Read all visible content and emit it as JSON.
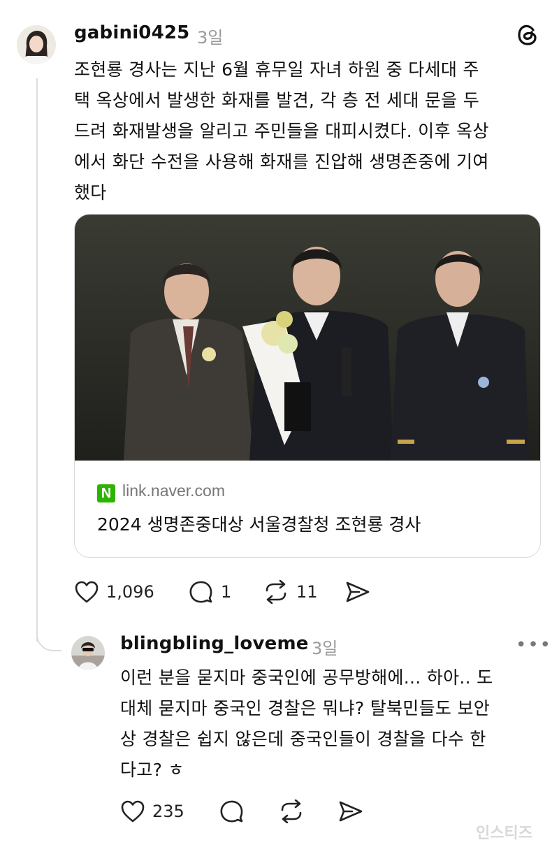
{
  "post": {
    "username": "gabini0425",
    "time": "3일",
    "app_icon": "threads-logo-icon",
    "text": "조현룡 경사는 지난 6월 휴무일 자녀 하원 중 다세대 주\n택 옥상에서 발생한 화재를 발견, 각 층 전 세대 문을 두\n드려 화재발생을 알리고 주민들을 대피시켰다. 이후 옥상\n에서 화단 수전을 사용해 화재를 진압해 생명존중에 기여\n했다",
    "link_card": {
      "domain": "link.naver.com",
      "badge": "N",
      "title": "2024 생명존중대상 서울경찰청 조현룡 경사"
    },
    "actions": {
      "likes": "1,096",
      "comments": "1",
      "reposts": "11"
    }
  },
  "reply": {
    "username": "blingbling_loveme",
    "time": "3일",
    "more": "•••",
    "text": "이런 분을 묻지마 중국인에 공무방해에... 하아.. 도\n대체 묻지마 중국인 경찰은 뭐냐? 탈북민들도 보안\n상 경찰은 쉽지 않은데 중국인들이 경찰을 다수 한\n다고? ㅎ",
    "actions": {
      "likes": "235"
    }
  },
  "watermark": "인스티즈",
  "colors": {
    "accent_green": "#2db400",
    "muted": "#9a9a9a",
    "border": "#d9d9d9"
  }
}
